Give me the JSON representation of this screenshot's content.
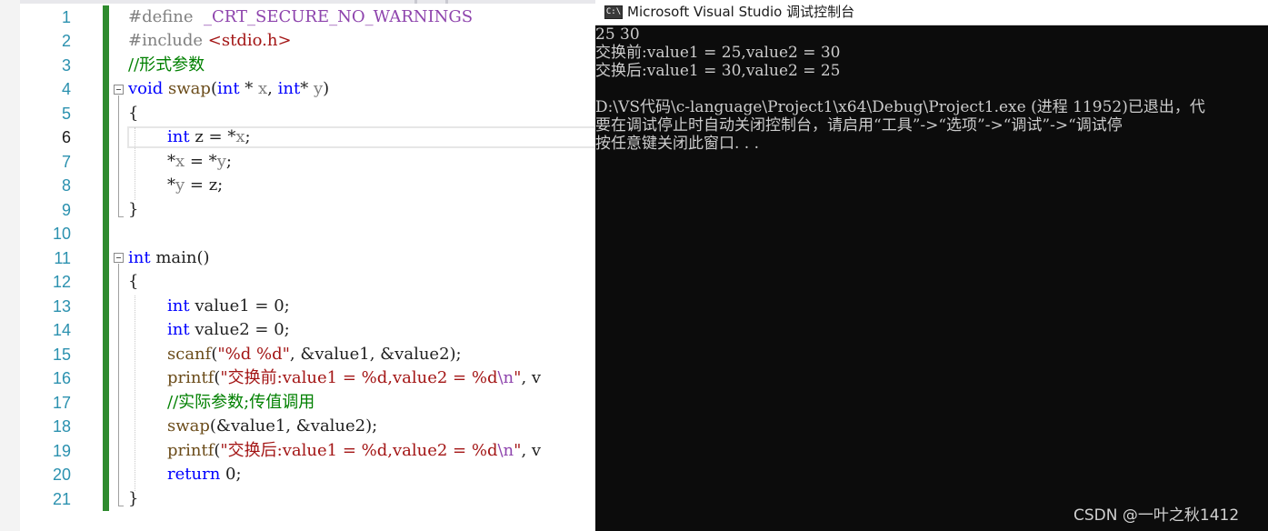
{
  "editor": {
    "line_numbers": [
      "1",
      "2",
      "3",
      "4",
      "5",
      "6",
      "7",
      "8",
      "9",
      "10",
      "11",
      "12",
      "13",
      "14",
      "15",
      "16",
      "17",
      "18",
      "19",
      "20",
      "21"
    ],
    "current_line": "6",
    "code": {
      "l1": {
        "kw": "#define",
        "macro": "_CRT_SECURE_NO_WARNINGS"
      },
      "l2": {
        "kw": "#include",
        "header": "<stdio.h>"
      },
      "l3": {
        "comment": "//形式参数"
      },
      "l4": {
        "void": "void",
        "name": "swap",
        "open": "(",
        "int1": "int",
        "p1": " * ",
        "x": "x",
        "sep": ", ",
        "int2": "int",
        "p2": "* ",
        "y": "y",
        "close": ")"
      },
      "l5": {
        "text": "{"
      },
      "l6": {
        "int": "int",
        "rest1": " z = *",
        "x": "x",
        "semi": ";"
      },
      "l7": {
        "text1": "*",
        "x": "x",
        "text2": " = *",
        "y": "y",
        "semi": ";"
      },
      "l8": {
        "text1": "*",
        "y": "y",
        "text2": " = z;"
      },
      "l9": {
        "text": "}"
      },
      "l11": {
        "int": "int",
        "rest": " main()"
      },
      "l12": {
        "text": "{"
      },
      "l13": {
        "int": "int",
        "rest": " value1 = 0;"
      },
      "l14": {
        "int": "int",
        "rest": " value2 = 0;"
      },
      "l15": {
        "fn": "scanf",
        "open": "(",
        "str": "\"%d %d\"",
        "rest": ", &value1, &value2);"
      },
      "l16": {
        "fn": "printf",
        "open": "(",
        "str": "\"交换前:value1 = %d,value2 = %d",
        "esc": "\\n",
        "strend": "\"",
        "rest": ", v"
      },
      "l17": {
        "comment": "//实际参数;传值调用"
      },
      "l18": {
        "fn": "swap",
        "rest": "(&value1, &value2);"
      },
      "l19": {
        "fn": "printf",
        "open": "(",
        "str": "\"交换后:value1 = %d,value2 = %d",
        "esc": "\\n",
        "strend": "\"",
        "rest": ", v"
      },
      "l20": {
        "kw": "return",
        "rest": " 0;"
      },
      "l21": {
        "text": "}"
      }
    }
  },
  "console": {
    "title": "Microsoft Visual Studio 调试控制台",
    "icon_text": "C:\\",
    "lines": [
      "25 30",
      "交换前:value1 = 25,value2 = 30",
      "交换后:value1 = 30,value2 = 25",
      "",
      "D:\\VS代码\\c-language\\Project1\\x64\\Debug\\Project1.exe (进程 11952)已退出，代",
      "要在调试停止时自动关闭控制台，请启用“工具”->“选项”->“调试”->“调试停",
      "按任意键关闭此窗口. . ."
    ],
    "watermark": "CSDN @一叶之秋1412"
  },
  "colors": {
    "keyword": "#0000ff",
    "comment": "#008000",
    "string": "#a31515",
    "line_number": "#2b91af",
    "change_bar": "#2e8b2e",
    "console_bg": "#0c0c0c"
  }
}
